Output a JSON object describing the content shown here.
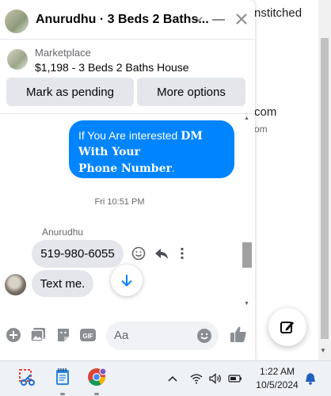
{
  "background": {
    "text_top": "nstitched",
    "text_mid": "com",
    "text_small": "om"
  },
  "chat": {
    "title": "Anurudhu · 3 Beds 2 Baths...",
    "marketplace_label": "Marketplace",
    "listing": "$1,198 - 3 Beds 2 Baths House",
    "mark_pending_label": "Mark as pending",
    "more_options_label": "More options",
    "outgoing_line1_a": "If You Are interested ",
    "outgoing_line1_b": "DM",
    "outgoing_line2": "With Your",
    "outgoing_line3": "Phone Number",
    "outgoing_line3_end": ".",
    "timestamp": "Fri 10:51 PM",
    "sender": "Anurudhu",
    "incoming1": "519-980-6055",
    "incoming2": "Text me.",
    "input_placeholder": "Aa"
  },
  "taskbar": {
    "time": "1:22 AM",
    "date": "10/5/2024"
  },
  "colors": {
    "accent": "#0084ff",
    "bubble_gray": "#e4e6eb",
    "icon_gray": "#8a8d91"
  },
  "icons": [
    "chevron-down-icon",
    "minimize-icon",
    "close-icon",
    "smile-icon",
    "reply-icon",
    "more-vertical-icon",
    "arrow-down-icon",
    "plus-icon",
    "image-icon",
    "sticker-icon",
    "gif-icon",
    "emoji-icon",
    "thumbs-up-icon",
    "compose-icon",
    "snipping-tool-icon",
    "notepad-icon",
    "chrome-icon",
    "chevron-up-icon",
    "wifi-icon",
    "speaker-icon",
    "battery-icon",
    "bell-icon"
  ]
}
